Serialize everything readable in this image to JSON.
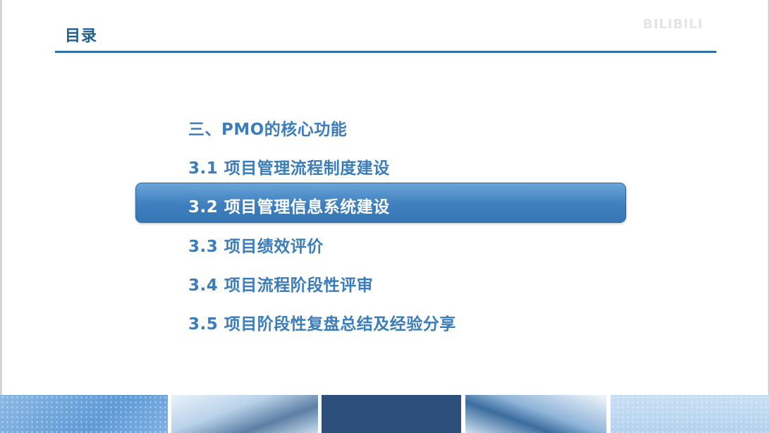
{
  "header": {
    "title": "目录",
    "watermark": "BILIBILI"
  },
  "toc": {
    "heading": "三、PMO的核心功能",
    "items": [
      {
        "label": "3.1 项目管理流程制度建设",
        "active": false
      },
      {
        "label": "3.2 项目管理信息系统建设",
        "active": true
      },
      {
        "label": "3.3 项目绩效评价",
        "active": false
      },
      {
        "label": "3.4 项目流程阶段性评审",
        "active": false
      },
      {
        "label": "3.5 项目阶段性复盘总结及经验分享",
        "active": false
      }
    ]
  },
  "colors": {
    "accent": "#2f6fa7",
    "text": "#3b7cba",
    "highlight": "#3f7fbf",
    "title": "#1f5d8c"
  }
}
